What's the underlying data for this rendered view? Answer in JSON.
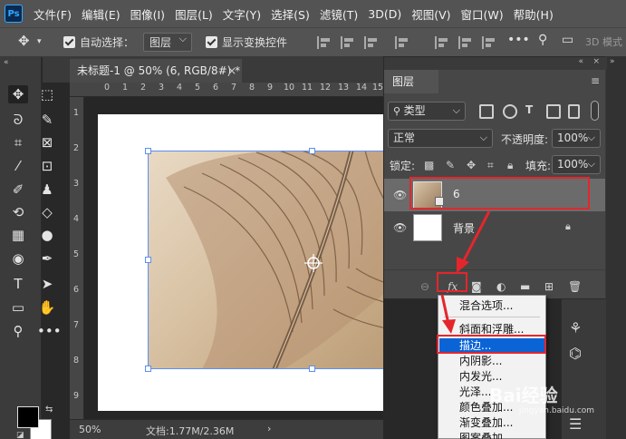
{
  "menubar": {
    "logo": "Ps",
    "items": [
      "文件(F)",
      "编辑(E)",
      "图像(I)",
      "图层(L)",
      "文字(Y)",
      "选择(S)",
      "滤镜(T)",
      "3D(D)",
      "视图(V)",
      "窗口(W)",
      "帮助(H)"
    ]
  },
  "options_bar": {
    "auto_select_label": "自动选择：",
    "auto_select_value": "图层",
    "show_transform_label": "显示变换控件",
    "mode_3d_label": "3D 模式"
  },
  "document": {
    "tab_title": "未标题-1 @ 50% (6, RGB/8#) *",
    "ruler_top_marks": [
      "0",
      "1",
      "2",
      "3",
      "4",
      "5",
      "6",
      "7",
      "8",
      "9",
      "10",
      "11",
      "12",
      "13",
      "14",
      "15"
    ],
    "ruler_left_marks": [
      "1",
      "2",
      "3",
      "4",
      "5",
      "6",
      "7",
      "8",
      "9"
    ],
    "zoom": "50%",
    "doc_info": "文档:1.77M/2.36M"
  },
  "layers_panel": {
    "title": "图层",
    "filter_kind": "类型",
    "blend_mode": "正常",
    "opacity_label": "不透明度:",
    "opacity_value": "100%",
    "lock_label": "锁定:",
    "fill_label": "填充:",
    "fill_value": "100%",
    "layers": [
      {
        "name": "6",
        "selected": true,
        "visible": true
      },
      {
        "name": "背景",
        "selected": false,
        "visible": true,
        "locked": true
      }
    ],
    "footer_icons": [
      "link-icon",
      "fx-icon",
      "mask-icon",
      "adjustment-icon",
      "group-icon",
      "new-layer-icon",
      "trash-icon"
    ],
    "fx_label": "fx"
  },
  "context_menu": {
    "items": [
      "混合选项...",
      "斜面和浮雕...",
      "描边...",
      "内阴影...",
      "内发光...",
      "光泽...",
      "颜色叠加...",
      "渐变叠加...",
      "图案叠加..."
    ],
    "selected_index": 2
  },
  "watermark": {
    "text": "Bai经验",
    "sub": "jingyan.baidu.com"
  },
  "colors": {
    "menubar_bg": "#535353",
    "panel_bg": "#474747",
    "highlight_red": "#e4262c",
    "menu_selected": "#0a64d6",
    "selection_blue": "#5d8ff2"
  }
}
